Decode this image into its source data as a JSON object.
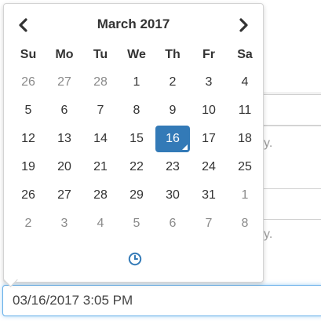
{
  "calendar": {
    "month_title": "March 2017",
    "prev_icon": "chevron-left-icon",
    "next_icon": "chevron-right-icon",
    "weekdays": [
      "Su",
      "Mo",
      "Tu",
      "We",
      "Th",
      "Fr",
      "Sa"
    ],
    "weeks": [
      [
        {
          "d": "26",
          "muted": true
        },
        {
          "d": "27",
          "muted": true
        },
        {
          "d": "28",
          "muted": true
        },
        {
          "d": "1"
        },
        {
          "d": "2"
        },
        {
          "d": "3"
        },
        {
          "d": "4"
        }
      ],
      [
        {
          "d": "5"
        },
        {
          "d": "6"
        },
        {
          "d": "7"
        },
        {
          "d": "8"
        },
        {
          "d": "9"
        },
        {
          "d": "10"
        },
        {
          "d": "11"
        }
      ],
      [
        {
          "d": "12"
        },
        {
          "d": "13"
        },
        {
          "d": "14"
        },
        {
          "d": "15"
        },
        {
          "d": "16",
          "active": true
        },
        {
          "d": "17"
        },
        {
          "d": "18"
        }
      ],
      [
        {
          "d": "19"
        },
        {
          "d": "20"
        },
        {
          "d": "21"
        },
        {
          "d": "22"
        },
        {
          "d": "23"
        },
        {
          "d": "24"
        },
        {
          "d": "25"
        }
      ],
      [
        {
          "d": "26"
        },
        {
          "d": "27"
        },
        {
          "d": "28"
        },
        {
          "d": "29"
        },
        {
          "d": "30"
        },
        {
          "d": "31"
        },
        {
          "d": "1",
          "muted": true
        }
      ],
      [
        {
          "d": "2",
          "muted": true
        },
        {
          "d": "3",
          "muted": true
        },
        {
          "d": "4",
          "muted": true
        },
        {
          "d": "5",
          "muted": true
        },
        {
          "d": "6",
          "muted": true
        },
        {
          "d": "7",
          "muted": true
        },
        {
          "d": "8",
          "muted": true
        }
      ]
    ],
    "clock_icon": "clock-icon"
  },
  "input": {
    "value": "03/16/2017 3:05 PM"
  },
  "background": {
    "text_1": "y.",
    "text_2": "y."
  },
  "colors": {
    "accent": "#337ab7",
    "focus": "#66afe9"
  }
}
